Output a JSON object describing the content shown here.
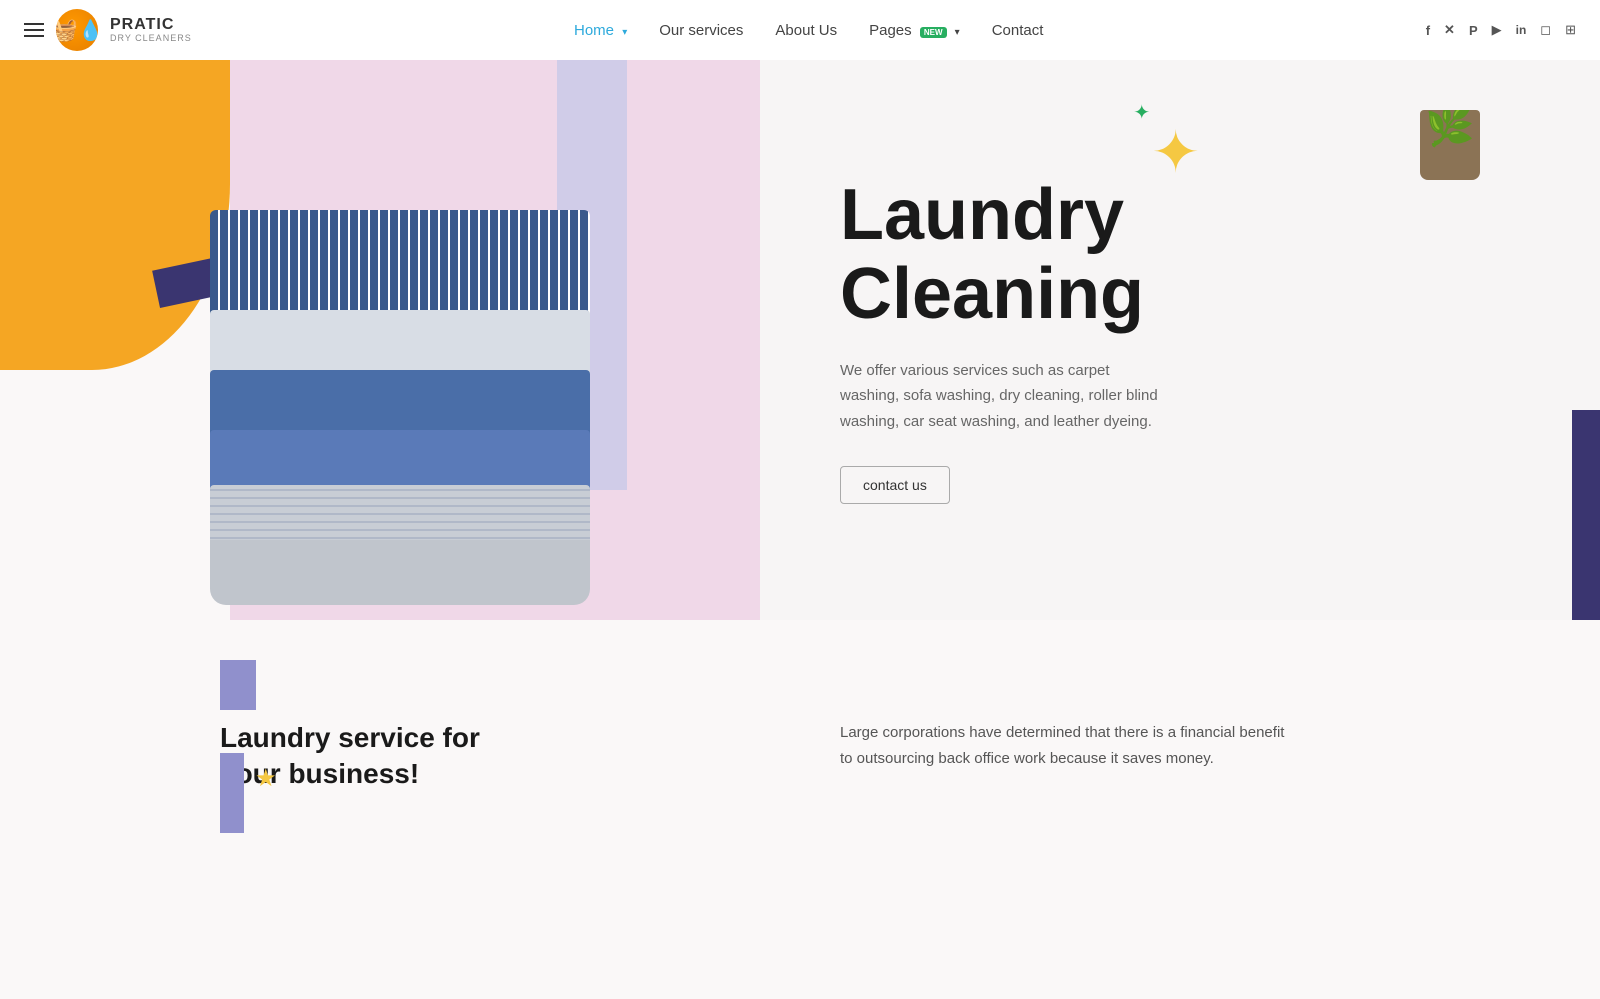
{
  "brand": {
    "name": "PRATIC",
    "subtitle": "Dry Cleaners",
    "logo_emoji": "💧"
  },
  "navbar": {
    "hamburger_label": "menu",
    "nav_items": [
      {
        "id": "home",
        "label": "Home",
        "active": true,
        "has_dropdown": true
      },
      {
        "id": "services",
        "label": "Our services",
        "active": false,
        "has_dropdown": false
      },
      {
        "id": "about",
        "label": "About Us",
        "active": false,
        "has_dropdown": false
      },
      {
        "id": "pages",
        "label": "Pages",
        "active": false,
        "has_dropdown": true,
        "badge": "NEW"
      },
      {
        "id": "contact",
        "label": "Contact",
        "active": false,
        "has_dropdown": false
      }
    ],
    "social_icons": [
      {
        "id": "facebook",
        "symbol": "f",
        "label": "Facebook"
      },
      {
        "id": "twitter",
        "symbol": "𝕏",
        "label": "Twitter/X"
      },
      {
        "id": "pinterest",
        "symbol": "P",
        "label": "Pinterest"
      },
      {
        "id": "youtube",
        "symbol": "▶",
        "label": "YouTube"
      },
      {
        "id": "linkedin",
        "symbol": "in",
        "label": "LinkedIn"
      },
      {
        "id": "instagram",
        "symbol": "◻",
        "label": "Instagram"
      },
      {
        "id": "extra",
        "symbol": "⊞",
        "label": "Extra"
      }
    ]
  },
  "hero": {
    "title_line1": "Laundry",
    "title_line2": "Cleaning",
    "description": "We offer various services such as carpet washing, sofa washing, dry cleaning, roller blind washing, car seat washing, and leather dyeing.",
    "cta_button": "contact us"
  },
  "lower": {
    "section_title_line1": "Laundry service for",
    "section_title_line2": "your business!",
    "description": "Large corporations have determined that there is a financial benefit to outsourcing back office work because it saves money."
  }
}
